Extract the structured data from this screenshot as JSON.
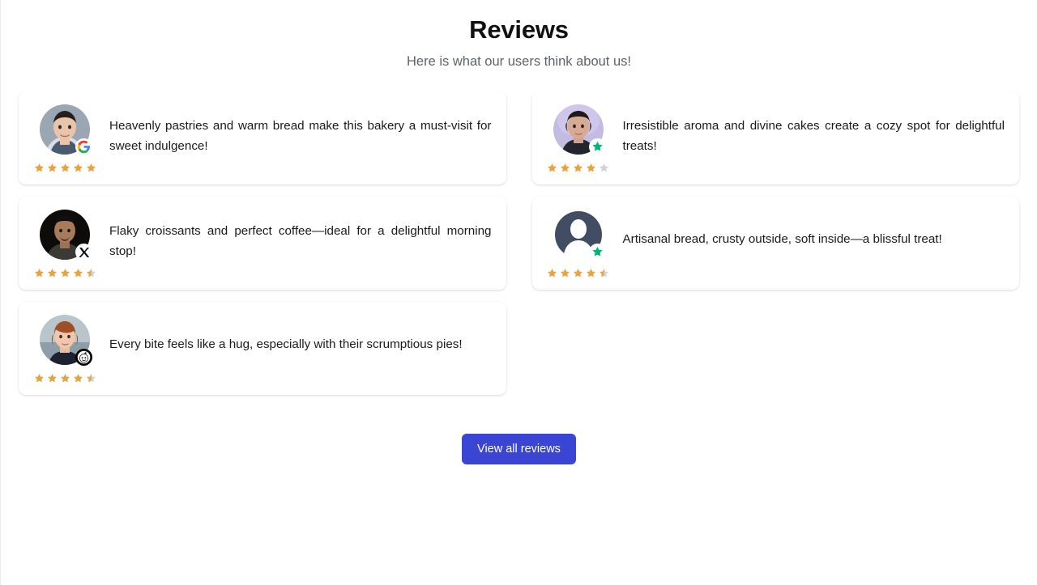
{
  "header": {
    "title": "Reviews",
    "subtitle": "Here is what our users think about us!"
  },
  "colors": {
    "star_filled": "#e8a33d",
    "star_empty": "#cfd4da",
    "button_bg": "#3b45d3",
    "button_text": "#ffffff",
    "title_text": "#111113",
    "subtitle_text": "#5f6368",
    "card_bg": "#ffffff",
    "page_bg": "#ffffff"
  },
  "reviews": [
    {
      "id": "review-1",
      "text": "Heavenly pastries and warm bread make this bakery a must-visit for sweet indulgence!",
      "rating": 5,
      "stars_full": 5,
      "stars_half": 0,
      "stars_empty": 0,
      "avatar": {
        "name": "avatar-photo-man-light-blue",
        "type": "photo"
      },
      "source_badge": "google-icon"
    },
    {
      "id": "review-2",
      "text": "Irresistible aroma and divine cakes create a cozy spot for delightful treats!",
      "rating": 4.5,
      "stars_full": 4,
      "stars_half": 0,
      "stars_empty": 1,
      "avatar": {
        "name": "avatar-photo-woman-purple",
        "type": "photo"
      },
      "source_badge": "trustpilot-icon"
    },
    {
      "id": "review-3",
      "text": "Flaky croissants and perfect coffee—ideal for a delightful morning stop!",
      "rating": 4.5,
      "stars_full": 4,
      "stars_half": 1,
      "stars_empty": 0,
      "avatar": {
        "name": "avatar-photo-man-dark",
        "type": "photo"
      },
      "source_badge": "x-twitter-icon"
    },
    {
      "id": "review-4",
      "text": "Artisanal bread, crusty outside, soft inside—a blissful treat!",
      "rating": 4.5,
      "stars_full": 4,
      "stars_half": 1,
      "stars_empty": 0,
      "avatar": {
        "name": "avatar-placeholder-silhouette",
        "type": "placeholder"
      },
      "source_badge": "trustpilot-icon"
    },
    {
      "id": "review-5",
      "text": "Every bite feels like a hug, especially with their scrumptious pies!",
      "rating": 4.5,
      "stars_full": 4,
      "stars_half": 1,
      "stars_empty": 0,
      "avatar": {
        "name": "avatar-photo-woman-redhair",
        "type": "photo"
      },
      "source_badge": "reddit-icon"
    }
  ],
  "footer": {
    "view_all_label": "View all reviews"
  }
}
